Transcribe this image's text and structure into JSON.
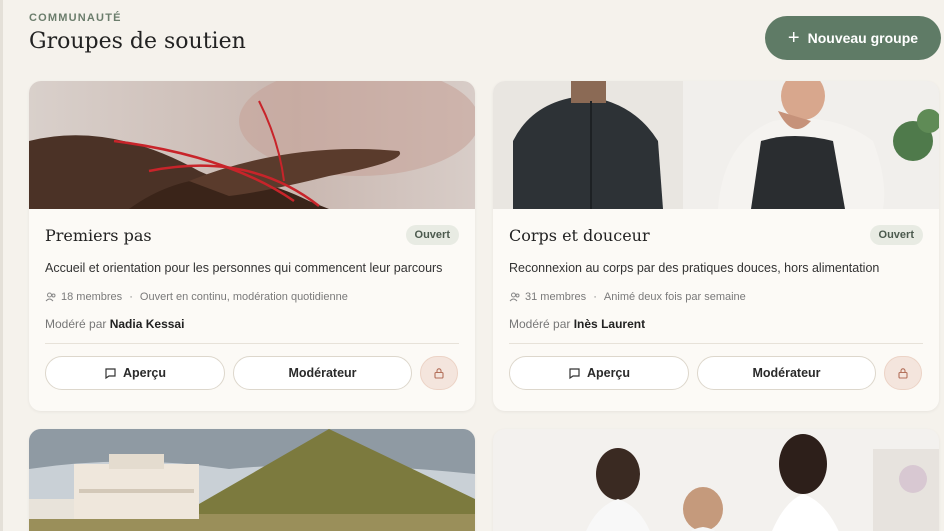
{
  "header": {
    "eyebrow": "COMMUNAUTÉ",
    "title": "Groupes de soutien",
    "new_button": "Nouveau groupe"
  },
  "colors": {
    "accent": "#5f7b66",
    "badge_bg": "#e8ebe3",
    "lock_bg": "#f4e5dd"
  },
  "groups": [
    {
      "name": "Premiers pas",
      "status": "Ouvert",
      "description": "Accueil et orientation pour les personnes qui commencent leur parcours",
      "members": "18 membres",
      "schedule": "Ouvert en continu, modération quotidienne",
      "moderated_prefix": "Modéré par",
      "moderator": "Nadia Kessai",
      "preview_label": "Aperçu",
      "moderator_label": "Modérateur"
    },
    {
      "name": "Corps et douceur",
      "status": "Ouvert",
      "description": "Reconnexion au corps par des pratiques douces, hors alimentation",
      "members": "31 membres",
      "schedule": "Animé deux fois par semaine",
      "moderated_prefix": "Modéré par",
      "moderator": "Inès Laurent",
      "preview_label": "Aperçu",
      "moderator_label": "Modérateur"
    }
  ]
}
